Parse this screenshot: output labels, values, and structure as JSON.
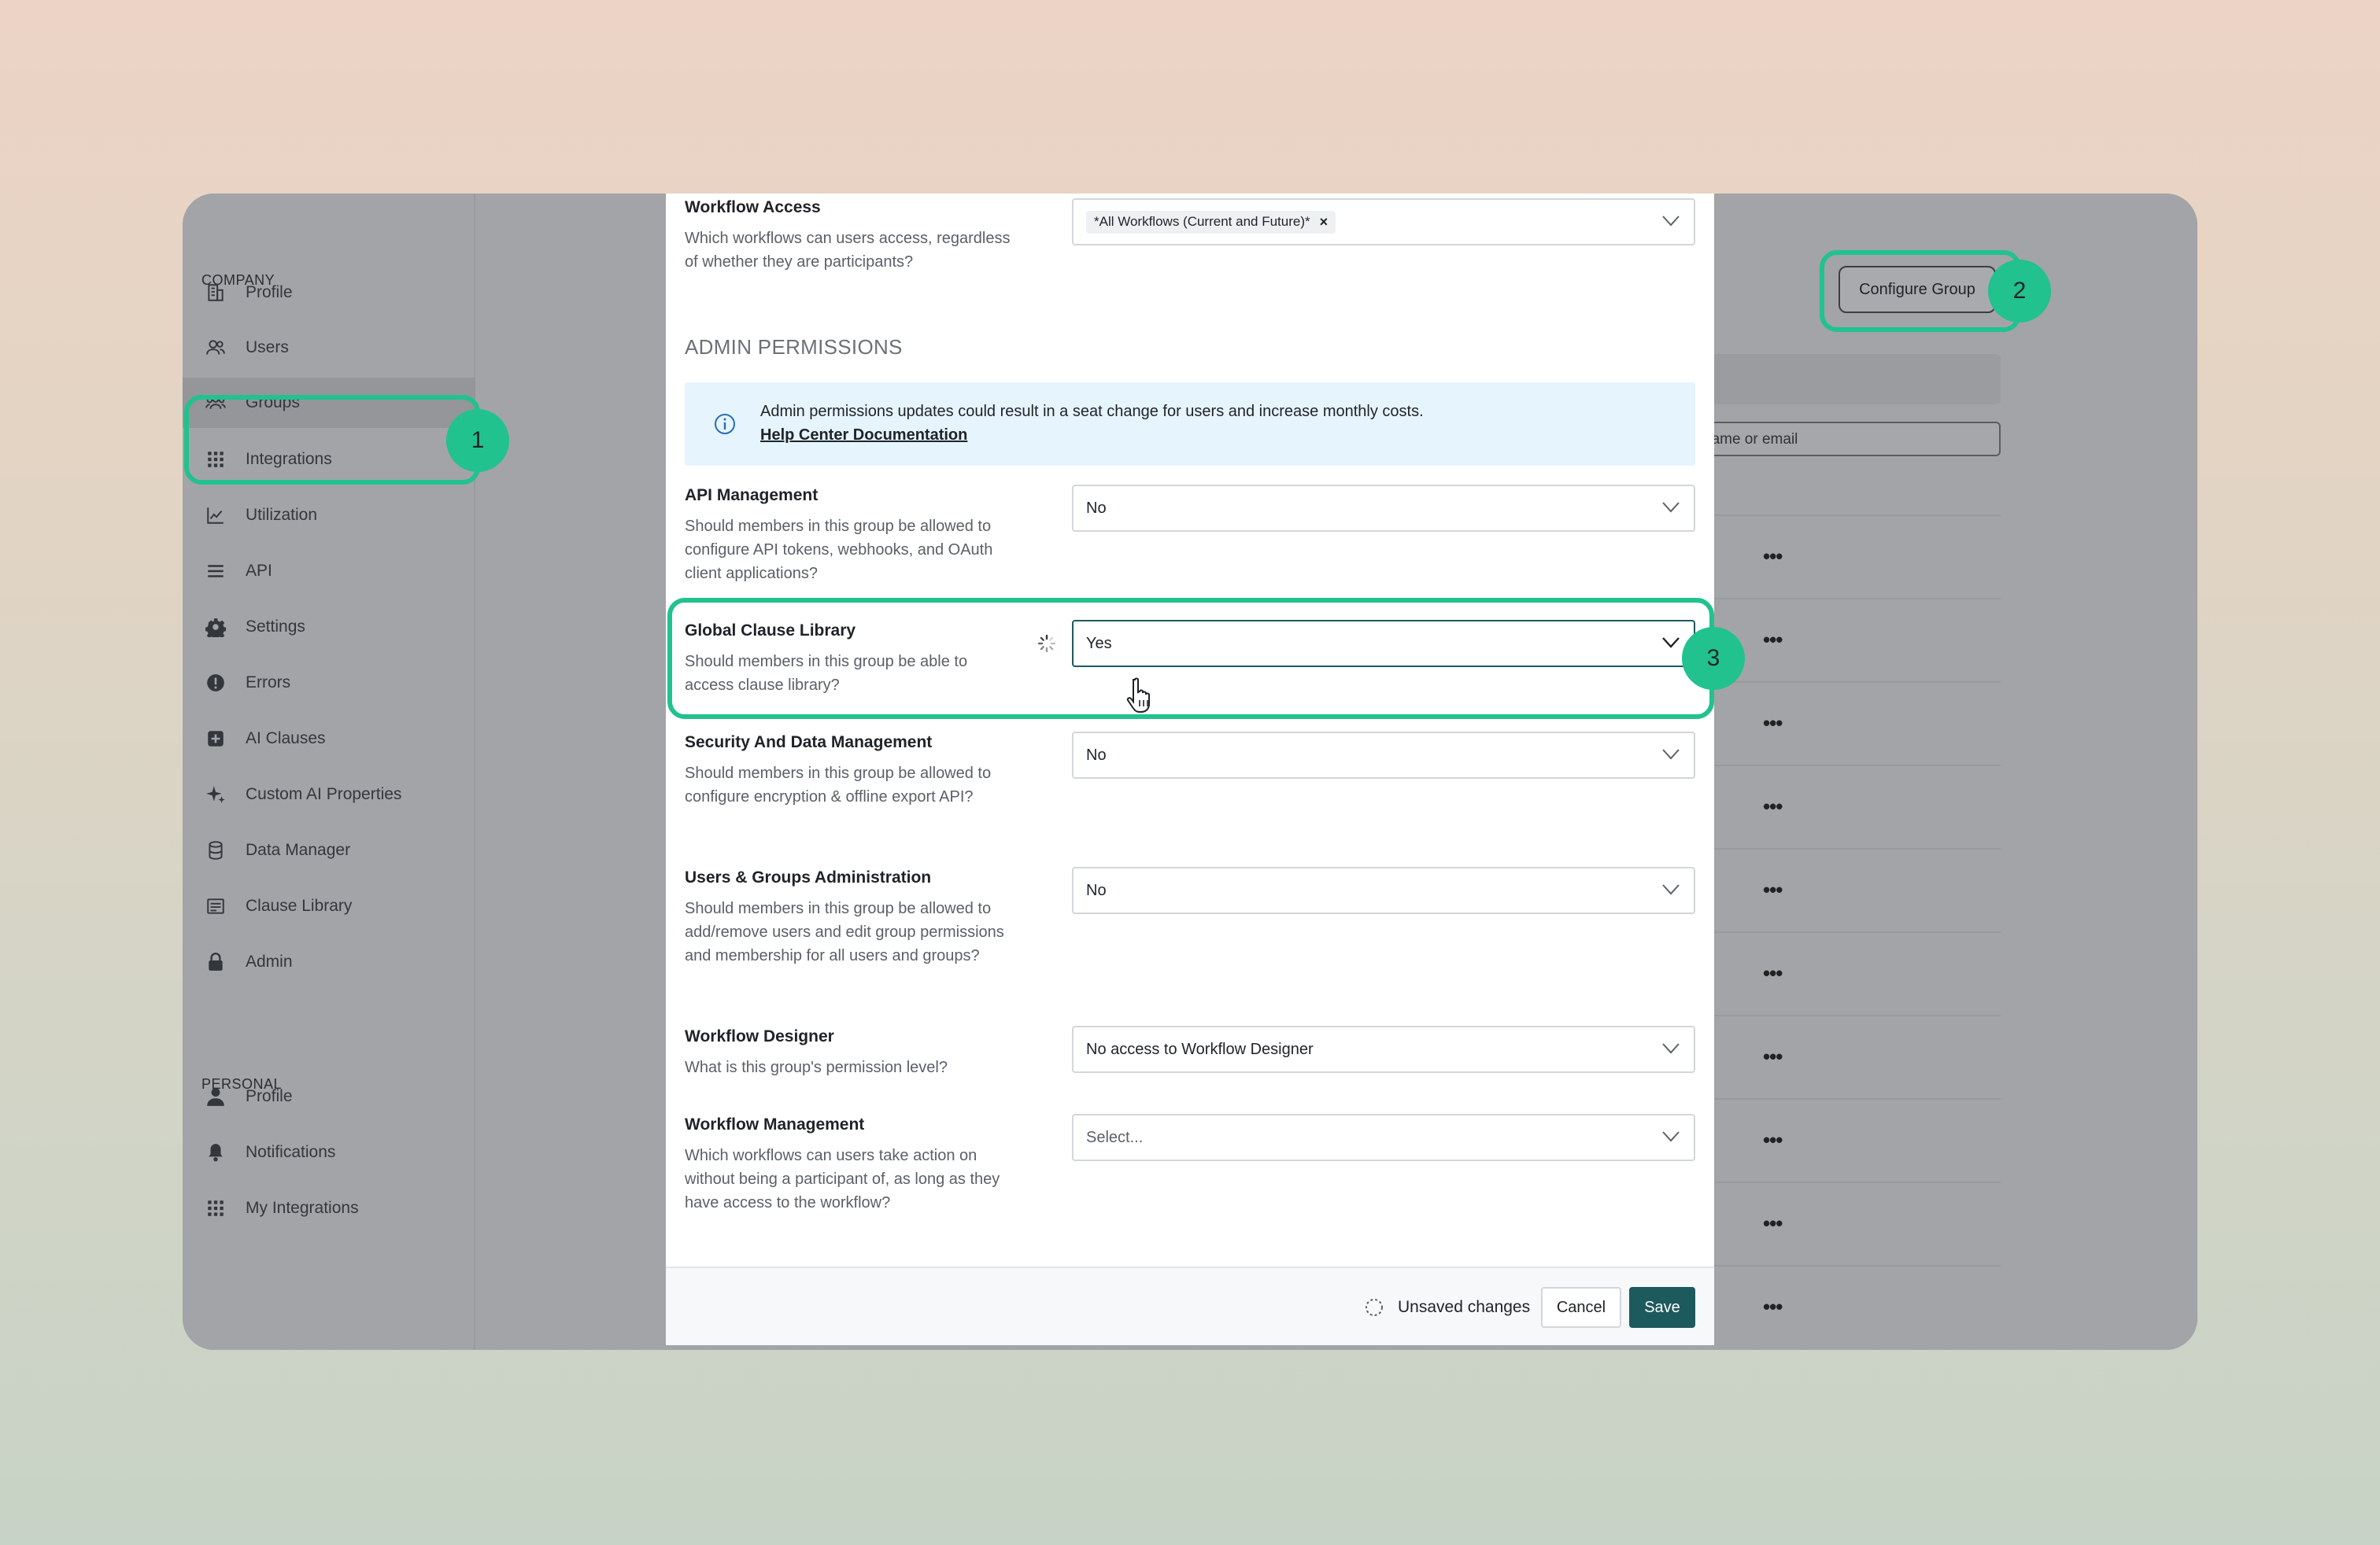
{
  "sidebar": {
    "company_label": "COMPANY",
    "personal_label": "PERSONAL",
    "company_items": [
      {
        "label": "Profile",
        "icon": "building-icon"
      },
      {
        "label": "Users",
        "icon": "users-icon"
      },
      {
        "label": "Groups",
        "icon": "groups-icon"
      },
      {
        "label": "Integrations",
        "icon": "grid-icon"
      },
      {
        "label": "Utilization",
        "icon": "chart-icon"
      },
      {
        "label": "API",
        "icon": "list-icon"
      },
      {
        "label": "Settings",
        "icon": "gear-icon"
      },
      {
        "label": "Errors",
        "icon": "alert-icon"
      },
      {
        "label": "AI Clauses",
        "icon": "plus-square-icon"
      },
      {
        "label": "Custom AI Properties",
        "icon": "sparkle-icon"
      },
      {
        "label": "Data Manager",
        "icon": "database-icon"
      },
      {
        "label": "Clause Library",
        "icon": "document-icon"
      },
      {
        "label": "Admin",
        "icon": "lock-icon"
      }
    ],
    "personal_items": [
      {
        "label": "Profile",
        "icon": "person-icon"
      },
      {
        "label": "Notifications",
        "icon": "bell-icon"
      },
      {
        "label": "My Integrations",
        "icon": "grid-icon"
      }
    ],
    "active_item": "Groups"
  },
  "background": {
    "configure_group_label": "Configure Group",
    "search_placeholder": "name or email",
    "row_action": "•••"
  },
  "modal": {
    "workflow_access": {
      "title": "Workflow Access",
      "description": "Which workflows can users access, regardless of whether they are participants?",
      "tag": "*All Workflows (Current and Future)*",
      "tag_remove": "×"
    },
    "admin_heading": "ADMIN PERMISSIONS",
    "banner": {
      "text": "Admin permissions updates could result in a seat change for users and increase monthly costs.",
      "link": "Help Center Documentation"
    },
    "fields": [
      {
        "title": "API Management",
        "description": "Should members in this group be allowed to configure API tokens, webhooks, and OAuth client applications?",
        "value": "No"
      },
      {
        "title": "Global Clause Library",
        "description": "Should members in this group be able to access clause library?",
        "value": "Yes"
      },
      {
        "title": "Security And Data Management",
        "description": "Should members in this group be allowed to configure encryption & offline export API?",
        "value": "No"
      },
      {
        "title": "Users & Groups Administration",
        "description": "Should members in this group be allowed to add/remove users and edit group permissions and membership for all users and groups?",
        "value": "No"
      },
      {
        "title": "Workflow Designer",
        "description": "What is this group's permission level?",
        "value": "No access to Workflow Designer"
      },
      {
        "title": "Workflow Management",
        "description": "Which workflows can users take action on without being a participant of, as long as they have access to the workflow?",
        "value": "",
        "placeholder": "Select..."
      }
    ],
    "footer": {
      "unsaved": "Unsaved changes",
      "cancel": "Cancel",
      "save": "Save"
    }
  },
  "annotations": {
    "step1": "1",
    "step2": "2",
    "step3": "3",
    "color": "#21c28d"
  }
}
